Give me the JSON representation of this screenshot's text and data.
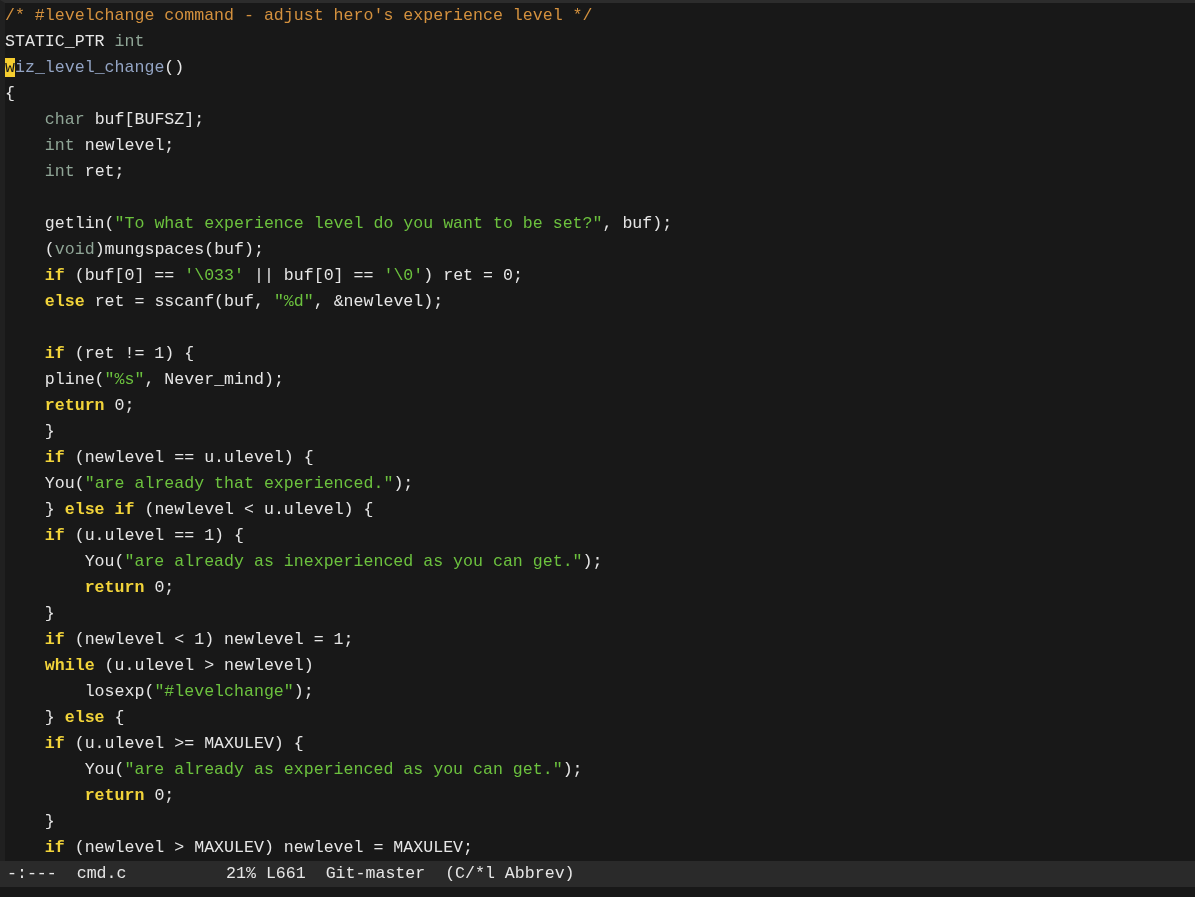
{
  "buffer": {
    "lines": [
      {
        "kind": "code",
        "tokens": [
          {
            "kind": "comment",
            "text": "/* #levelchange command - adjust hero's experience level */"
          }
        ]
      },
      {
        "kind": "code",
        "tokens": [
          {
            "kind": "plain",
            "text": "STATIC_PTR "
          },
          {
            "kind": "type",
            "text": "int"
          }
        ]
      },
      {
        "kind": "code",
        "tokens": [
          {
            "kind": "cursor",
            "text": "w"
          },
          {
            "kind": "func",
            "text": "iz_level_change"
          },
          {
            "kind": "plain",
            "text": "()"
          }
        ]
      },
      {
        "kind": "code",
        "tokens": [
          {
            "kind": "plain",
            "text": "{"
          }
        ]
      },
      {
        "kind": "code",
        "tokens": [
          {
            "kind": "type",
            "text": "    char"
          },
          {
            "kind": "plain",
            "text": " buf[BUFSZ];"
          }
        ]
      },
      {
        "kind": "code",
        "tokens": [
          {
            "kind": "type",
            "text": "    int"
          },
          {
            "kind": "plain",
            "text": " newlevel;"
          }
        ]
      },
      {
        "kind": "code",
        "tokens": [
          {
            "kind": "type",
            "text": "    int"
          },
          {
            "kind": "plain",
            "text": " ret;"
          }
        ]
      },
      {
        "kind": "blank"
      },
      {
        "kind": "code",
        "tokens": [
          {
            "kind": "plain",
            "text": "    getlin("
          },
          {
            "kind": "string",
            "text": "\"To what experience level do you want to be set?\""
          },
          {
            "kind": "plain",
            "text": ", buf);"
          }
        ]
      },
      {
        "kind": "code",
        "tokens": [
          {
            "kind": "plain",
            "text": "    ("
          },
          {
            "kind": "type",
            "text": "void"
          },
          {
            "kind": "plain",
            "text": ")mungspaces(buf);"
          }
        ]
      },
      {
        "kind": "code",
        "tokens": [
          {
            "kind": "keyword",
            "text": "    if"
          },
          {
            "kind": "plain",
            "text": " (buf[0] == "
          },
          {
            "kind": "string",
            "text": "'\\033'"
          },
          {
            "kind": "plain",
            "text": " || buf[0] == "
          },
          {
            "kind": "string",
            "text": "'\\0'"
          },
          {
            "kind": "plain",
            "text": ") ret = 0;"
          }
        ]
      },
      {
        "kind": "code",
        "tokens": [
          {
            "kind": "keyword",
            "text": "    else"
          },
          {
            "kind": "plain",
            "text": " ret = sscanf(buf, "
          },
          {
            "kind": "string",
            "text": "\"%d\""
          },
          {
            "kind": "plain",
            "text": ", &newlevel);"
          }
        ]
      },
      {
        "kind": "blank"
      },
      {
        "kind": "code",
        "tokens": [
          {
            "kind": "keyword",
            "text": "    if"
          },
          {
            "kind": "plain",
            "text": " (ret != 1) {"
          }
        ]
      },
      {
        "kind": "code",
        "tokens": [
          {
            "kind": "plain",
            "text": "    pline("
          },
          {
            "kind": "string",
            "text": "\"%s\""
          },
          {
            "kind": "plain",
            "text": ", Never_mind);"
          }
        ]
      },
      {
        "kind": "code",
        "tokens": [
          {
            "kind": "keyword",
            "text": "    return"
          },
          {
            "kind": "plain",
            "text": " 0;"
          }
        ]
      },
      {
        "kind": "code",
        "tokens": [
          {
            "kind": "plain",
            "text": "    }"
          }
        ]
      },
      {
        "kind": "code",
        "tokens": [
          {
            "kind": "keyword",
            "text": "    if"
          },
          {
            "kind": "plain",
            "text": " (newlevel == u.ulevel) {"
          }
        ]
      },
      {
        "kind": "code",
        "tokens": [
          {
            "kind": "plain",
            "text": "    You("
          },
          {
            "kind": "string",
            "text": "\"are already that experienced.\""
          },
          {
            "kind": "plain",
            "text": ");"
          }
        ]
      },
      {
        "kind": "code",
        "tokens": [
          {
            "kind": "plain",
            "text": "    } "
          },
          {
            "kind": "keyword",
            "text": "else if"
          },
          {
            "kind": "plain",
            "text": " (newlevel < u.ulevel) {"
          }
        ]
      },
      {
        "kind": "code",
        "tokens": [
          {
            "kind": "keyword",
            "text": "    if"
          },
          {
            "kind": "plain",
            "text": " (u.ulevel == 1) {"
          }
        ]
      },
      {
        "kind": "code",
        "tokens": [
          {
            "kind": "plain",
            "text": "        You("
          },
          {
            "kind": "string",
            "text": "\"are already as inexperienced as you can get.\""
          },
          {
            "kind": "plain",
            "text": ");"
          }
        ]
      },
      {
        "kind": "code",
        "tokens": [
          {
            "kind": "keyword",
            "text": "        return"
          },
          {
            "kind": "plain",
            "text": " 0;"
          }
        ]
      },
      {
        "kind": "code",
        "tokens": [
          {
            "kind": "plain",
            "text": "    }"
          }
        ]
      },
      {
        "kind": "code",
        "tokens": [
          {
            "kind": "keyword",
            "text": "    if"
          },
          {
            "kind": "plain",
            "text": " (newlevel < 1) newlevel = 1;"
          }
        ]
      },
      {
        "kind": "code",
        "tokens": [
          {
            "kind": "keyword",
            "text": "    while"
          },
          {
            "kind": "plain",
            "text": " (u.ulevel > newlevel)"
          }
        ]
      },
      {
        "kind": "code",
        "tokens": [
          {
            "kind": "plain",
            "text": "        losexp("
          },
          {
            "kind": "string",
            "text": "\"#levelchange\""
          },
          {
            "kind": "plain",
            "text": ");"
          }
        ]
      },
      {
        "kind": "code",
        "tokens": [
          {
            "kind": "plain",
            "text": "    } "
          },
          {
            "kind": "keyword",
            "text": "else"
          },
          {
            "kind": "plain",
            "text": " {"
          }
        ]
      },
      {
        "kind": "code",
        "tokens": [
          {
            "kind": "keyword",
            "text": "    if"
          },
          {
            "kind": "plain",
            "text": " (u.ulevel >= MAXULEV) {"
          }
        ]
      },
      {
        "kind": "code",
        "tokens": [
          {
            "kind": "plain",
            "text": "        You("
          },
          {
            "kind": "string",
            "text": "\"are already as experienced as you can get.\""
          },
          {
            "kind": "plain",
            "text": ");"
          }
        ]
      },
      {
        "kind": "code",
        "tokens": [
          {
            "kind": "keyword",
            "text": "        return"
          },
          {
            "kind": "plain",
            "text": " 0;"
          }
        ]
      },
      {
        "kind": "code",
        "tokens": [
          {
            "kind": "plain",
            "text": "    }"
          }
        ]
      },
      {
        "kind": "code",
        "tokens": [
          {
            "kind": "keyword",
            "text": "    if"
          },
          {
            "kind": "plain",
            "text": " (newlevel > MAXULEV) newlevel = MAXULEV;"
          }
        ]
      }
    ]
  },
  "mode_line": {
    "status": "-:---",
    "buffer_name": "cmd.c",
    "position": "21% L661",
    "vc": "Git-master",
    "modes": "(C/*l Abbrev)"
  }
}
